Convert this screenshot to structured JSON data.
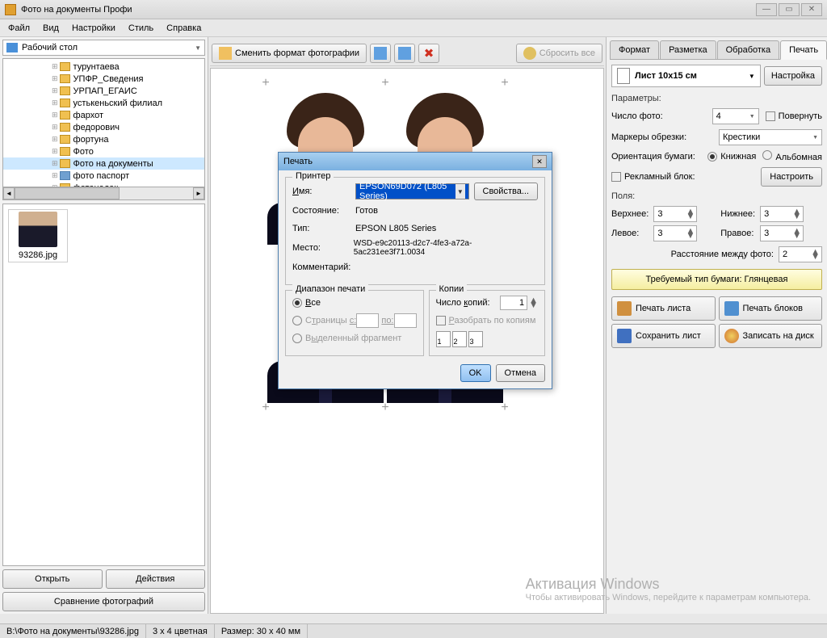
{
  "window": {
    "title": "Фото на документы Профи"
  },
  "menu": [
    "Файл",
    "Вид",
    "Настройки",
    "Стиль",
    "Справка"
  ],
  "left": {
    "location": "Рабочий стол",
    "tree": [
      {
        "label": "турунтаева"
      },
      {
        "label": "УПФР_Сведения"
      },
      {
        "label": "УРПАП_ЕГАИС"
      },
      {
        "label": "устькеньский филиал"
      },
      {
        "label": "фархот"
      },
      {
        "label": "федорович"
      },
      {
        "label": "фортуна"
      },
      {
        "label": "Фото"
      },
      {
        "label": "Фото на документы",
        "sel": true
      },
      {
        "label": "фото паспорт",
        "blue": true
      },
      {
        "label": "фотонадок"
      }
    ],
    "thumb_name": "93286.jpg",
    "open_btn": "Открыть",
    "actions_btn": "Действия",
    "compare_btn": "Сравнение фотографий"
  },
  "toolbar": {
    "change_format": "Сменить формат фотографии",
    "reset": "Сбросить все"
  },
  "tabs": [
    "Формат",
    "Разметка",
    "Обработка",
    "Печать"
  ],
  "right": {
    "paper": "Лист 10x15 см",
    "settings_btn": "Настройка",
    "params_label": "Параметры:",
    "count_label": "Число фото:",
    "count_value": "4",
    "rotate_label": "Повернуть",
    "markers_label": "Маркеры обрезки:",
    "markers_value": "Крестики",
    "orient_label": "Ориентация бумаги:",
    "orient_portrait": "Книжная",
    "orient_landscape": "Альбомная",
    "ad_label": "Рекламный блок:",
    "ad_btn": "Настроить",
    "margins_label": "Поля:",
    "top": "Верхнее:",
    "bottom": "Нижнее:",
    "left": "Левое:",
    "right": "Правое:",
    "margin_values": {
      "top": "3",
      "bottom": "3",
      "left": "3",
      "right": "3"
    },
    "spacing_label": "Расстояние между фото:",
    "spacing_value": "2",
    "paper_type": "Требуемый тип бумаги: Глянцевая",
    "print_sheet": "Печать листа",
    "print_blocks": "Печать блоков",
    "save_sheet": "Сохранить лист",
    "write_disc": "Записать на диск"
  },
  "dialog": {
    "title": "Печать",
    "printer_section": "Принтер",
    "name_label": "Имя:",
    "printer_name": "EPSON69D072 (L805 Series)",
    "props_btn": "Свойства...",
    "state_label": "Состояние:",
    "state_value": "Готов",
    "type_label": "Тип:",
    "type_value": "EPSON L805 Series",
    "where_label": "Место:",
    "where_value": "WSD-e9c20113-d2c7-4fe3-a72a-5ac231ee3f71.0034",
    "comment_label": "Комментарий:",
    "range_section": "Диапазон печати",
    "range_all": "Все",
    "range_pages": "Страницы",
    "from": "с:",
    "to": "по:",
    "range_selection": "Выделенный фрагмент",
    "copies_section": "Копии",
    "copies_label": "Число копий:",
    "copies_value": "1",
    "collate_label": "Разобрать по копиям",
    "ok": "OK",
    "cancel": "Отмена"
  },
  "watermark": {
    "title": "Активация Windows",
    "text": "Чтобы активировать Windows, перейдите к параметрам компьютера."
  },
  "status": {
    "path": "B:\\Фото на документы\\93286.jpg",
    "mode": "3 x 4 цветная",
    "size": "Размер: 30 x 40 мм"
  }
}
